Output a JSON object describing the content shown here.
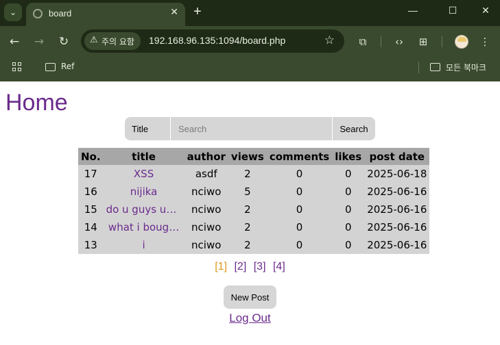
{
  "browser": {
    "tab": {
      "title": "board",
      "close": "✕"
    },
    "new_tab": "+",
    "window_controls": {
      "minimize": "—",
      "maximize": "☐",
      "close": "✕"
    },
    "security_chip": "주의 요함",
    "url": "192.168.96.135:1094/board.php",
    "bookmarks": [
      {
        "label": "Ref"
      },
      {
        "label": "모든 북마크"
      }
    ]
  },
  "page": {
    "title": "Home",
    "search": {
      "field": "Title",
      "placeholder": "Search",
      "button": "Search"
    },
    "table": {
      "headers": [
        "No.",
        "title",
        "author",
        "views",
        "comments",
        "likes",
        "post date"
      ],
      "rows": [
        {
          "no": "17",
          "title": "XSS",
          "author": "asdf",
          "views": "2",
          "comments": "0",
          "likes": "0",
          "date": "2025-06-18"
        },
        {
          "no": "16",
          "title": "nijika",
          "author": "nciwo",
          "views": "5",
          "comments": "0",
          "likes": "0",
          "date": "2025-06-16"
        },
        {
          "no": "15",
          "title": "do u guys us…",
          "author": "nciwo",
          "views": "2",
          "comments": "0",
          "likes": "0",
          "date": "2025-06-16"
        },
        {
          "no": "14",
          "title": "what i boug…",
          "author": "nciwo",
          "views": "2",
          "comments": "0",
          "likes": "0",
          "date": "2025-06-16"
        },
        {
          "no": "13",
          "title": "i",
          "author": "nciwo",
          "views": "2",
          "comments": "0",
          "likes": "0",
          "date": "2025-06-16"
        }
      ]
    },
    "pagination": [
      "[1]",
      "[2]",
      "[3]",
      "[4]"
    ],
    "new_post": "New Post",
    "logout": "Log Out"
  },
  "colors": {
    "link": "#6a2a8c",
    "current_page": "#e0961c",
    "chrome_dark": "#1f2a16",
    "chrome": "#3a4a2e"
  }
}
